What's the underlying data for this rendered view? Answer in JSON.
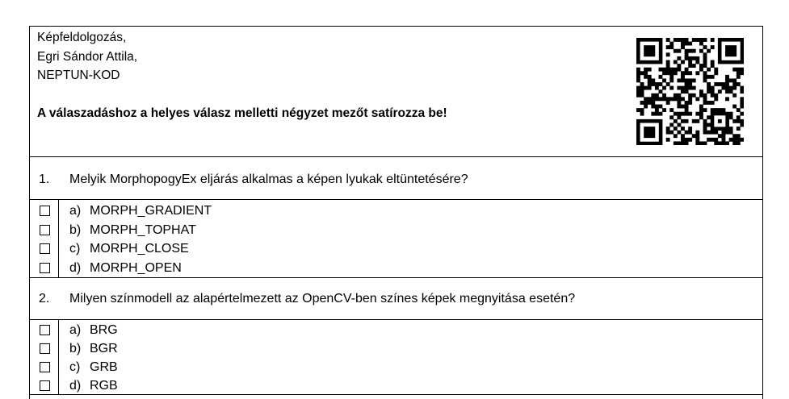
{
  "header": {
    "line1": "Képfeldolgozás,",
    "line2": "Egri Sándor Attila,",
    "line3": "NEPTUN-KOD",
    "instruction": "A válaszadáshoz a helyes válasz melletti négyzet mezőt satírozza be!"
  },
  "qr_code": {
    "icon": "qr-code"
  },
  "questions": [
    {
      "number": "1.",
      "text": "Melyik MorphopogyEx eljárás alkalmas a képen lyukak eltüntetésére?",
      "options": [
        {
          "letter": "a)",
          "text": "MORPH_GRADIENT",
          "checked": false
        },
        {
          "letter": "b)",
          "text": "MORPH_TOPHAT",
          "checked": false
        },
        {
          "letter": "c)",
          "text": "MORPH_CLOSE",
          "checked": false
        },
        {
          "letter": "d)",
          "text": "MORPH_OPEN",
          "checked": false
        }
      ]
    },
    {
      "number": "2.",
      "text": "Milyen színmodell az alapértelmezett az OpenCV-ben színes képek megnyitása esetén?",
      "options": [
        {
          "letter": "a)",
          "text": "BRG",
          "checked": false
        },
        {
          "letter": "b)",
          "text": "BGR",
          "checked": false
        },
        {
          "letter": "c)",
          "text": "GRB",
          "checked": false
        },
        {
          "letter": "d)",
          "text": "RGB",
          "checked": false
        }
      ]
    }
  ]
}
